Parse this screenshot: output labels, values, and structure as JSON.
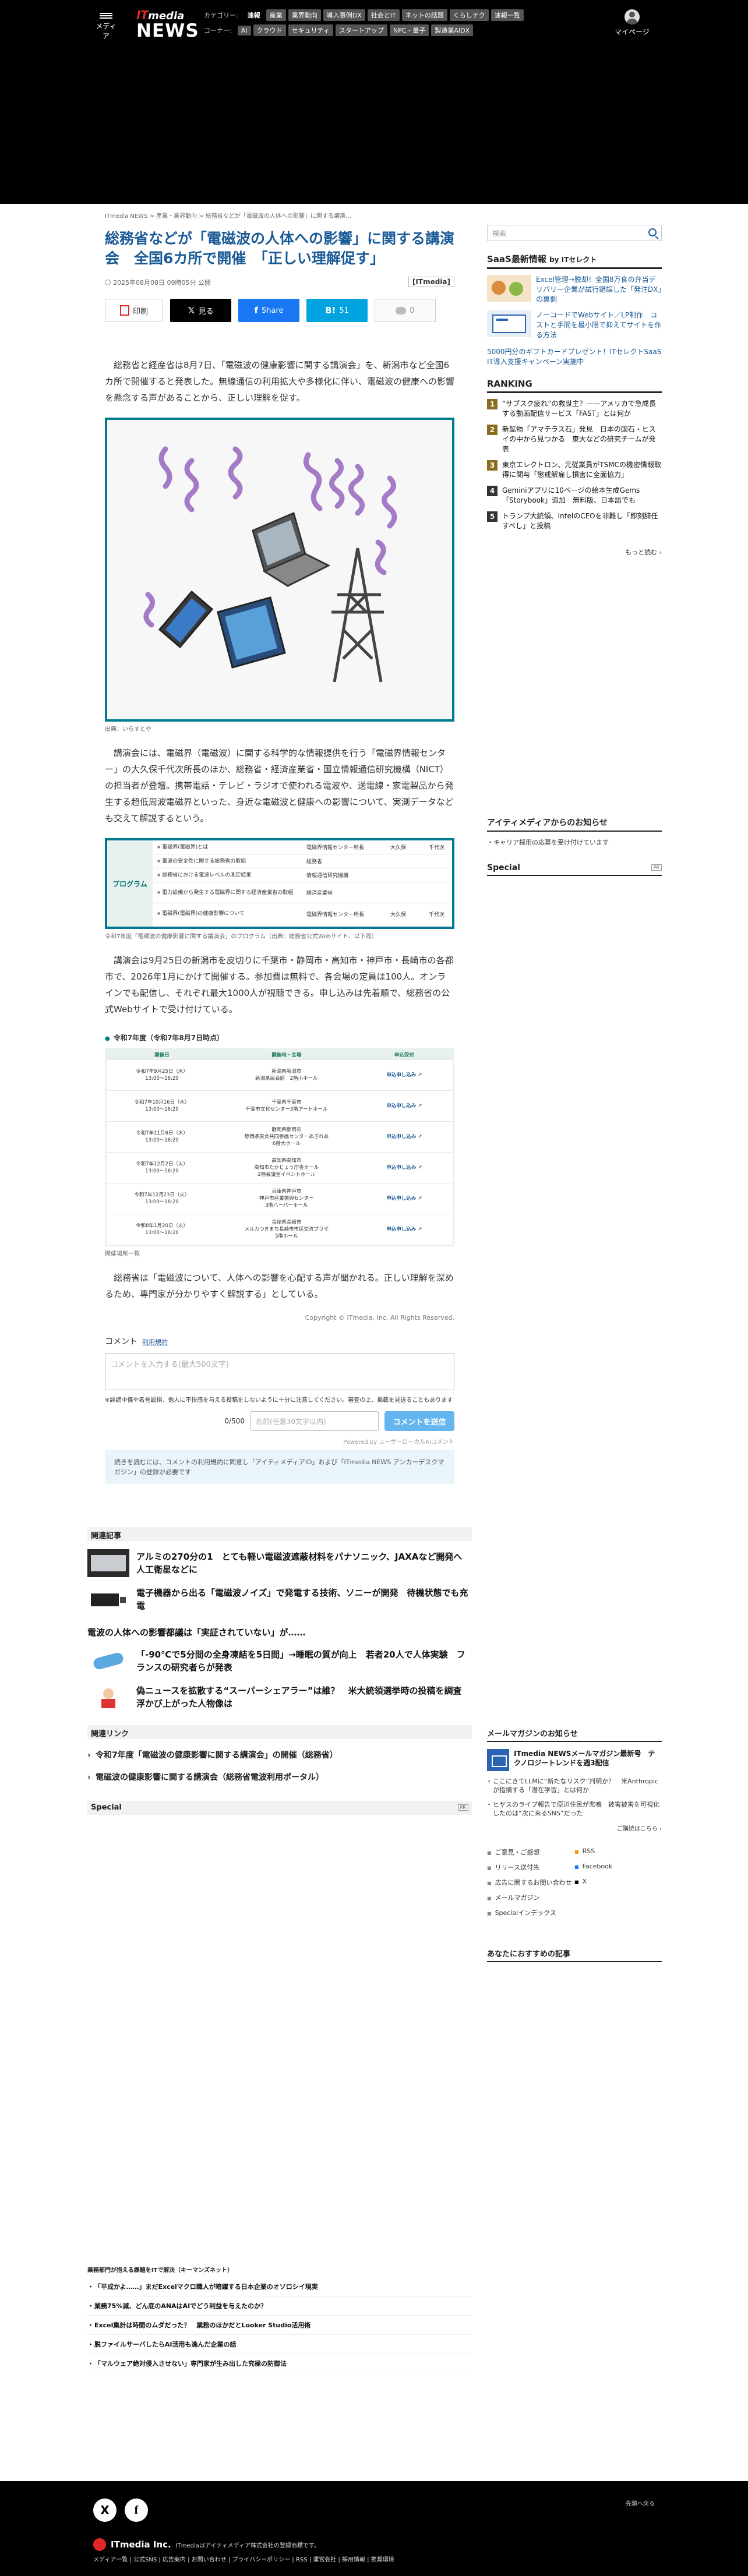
{
  "header": {
    "menu_label": "メディア",
    "logo_it": "IT",
    "logo_media": "media",
    "logo_news": "NEWS",
    "category_label": "カテゴリー:",
    "categories": [
      "速報",
      "産業",
      "業界動向",
      "導入事例DX",
      "社会とIT",
      "ネットの話題",
      "くらしテク",
      "速報一覧"
    ],
    "corner_label": "コーナー:",
    "corners": [
      "AI",
      "クラウド",
      "セキュリティ",
      "スタートアップ",
      "NPC・量子",
      "製造業AIDX"
    ],
    "mypage_label": "マイページ"
  },
  "breadcrumb": "ITmedia NEWS > 産業・業界動向 > 総務省などが「電磁波の人体への影響」に関する講演…",
  "article": {
    "title": "総務省などが「電磁波の人体への影響」に関する講演会　全国6カ所で開催　「正しい理解促す」",
    "datetime": "2025年08月08日 09時05分 公開",
    "source": "[ITmedia]",
    "share": {
      "print": "印刷",
      "x": "見る",
      "facebook": "Share",
      "hatena": "51",
      "comments": "0"
    },
    "lead": "総務省と経産省は8月7日、「電磁波の健康影響に関する講演会」を、新潟市など全国6カ所で開催すると発表した。無線通信の利用拡大や多様化に伴い、電磁波の健康への影響を懸念する声があることから、正しい理解を促す。",
    "fig_caption": "出典：いらすとや",
    "body2": "講演会には、電磁界（電磁波）に関する科学的な情報提供を行う「電磁界情報センター」の大久保千代次所長のほか、総務省・経済産業省・国立情報通信研究機構（NICT）の担当者が登壇。携帯電話・テレビ・ラジオで使われる電波や、送電線・家電製品から発生する超低周波電磁界といった、身近な電磁波と健康への影響について、実測データなども交えて解説するという。",
    "program": {
      "label": "プログラム",
      "rows": [
        {
          "c1": "電磁界(電磁界)とは",
          "c2": "電磁界情報センター所長",
          "c3": "大久保",
          "c4": "千代次"
        },
        {
          "c1": "電波の安全性に関する総務省の取組",
          "c2": "総務省",
          "c3": "",
          "c4": ""
        },
        {
          "c1": "総務省における電波レベルの測定結果",
          "c2": "情報通信研究機構",
          "c3": "",
          "c4": ""
        },
        {
          "c1": "電力設備から発生する電磁界に関する経済産業省の取組",
          "c2": "経済産業省",
          "c3": "",
          "c4": ""
        },
        {
          "c1": "電磁界(電磁界)の健康影響について",
          "c2": "電磁界情報センター所長",
          "c3": "大久保",
          "c4": "千代次"
        }
      ]
    },
    "program_caption": "令和7年度「電磁波の健康影響に関する講演会」のプログラム（出典：総務省公式Webサイト、以下同）",
    "body3": "講演会は9月25日の新潟市を皮切りに千葉市・静岡市・高知市・神戸市・長崎市の各都市で、2026年1月にかけて開催する。参加費は無料で、各会場の定員は100人。オンラインでも配信し、それぞれ最大1000人が視聴できる。申し込みは先着順で、総務省の公式Webサイトで受け付けている。",
    "schedule_title": "令和7年度（令和7年8月7日時点）",
    "schedule": {
      "headers": [
        "開催日",
        "開催地・会場",
        "申込受付"
      ],
      "rows": [
        {
          "date": "令和7年9月25日（木）\n13:00〜16:20",
          "place": "新潟県新潟市\n新潟県民会館　2階小ホール",
          "reg": "申込申し込み"
        },
        {
          "date": "令和7年10月16日（木）\n13:00〜16:20",
          "place": "千葉県千葉市\n千葉市文化センター3階アートホール",
          "reg": "申込申し込み"
        },
        {
          "date": "令和7年11月6日（木）\n13:00〜16:20",
          "place": "静岡県静岡市\n静岡県男女共同参画センターあざれあ\n6階大ホール",
          "reg": "申込申し込み"
        },
        {
          "date": "令和7年12月2日（火）\n13:00〜16:20",
          "place": "高知県高知市\n高知市たかじょう庁舎ホール\n2階会議室イベントホール",
          "reg": "申込申し込み"
        },
        {
          "date": "令和7年12月23日（火）\n13:00〜16:20",
          "place": "兵庫県神戸市\n神戸市産業振興センター\n3階ハーバーホール",
          "reg": "申込申し込み"
        },
        {
          "date": "令和8年1月20日（火）\n13:00〜16:20",
          "place": "長崎県長崎市\nメルカつきまち長崎市市民交流プラザ\n5階ホール",
          "reg": "申込申し込み"
        }
      ]
    },
    "schedule_caption": "開催場所一覧",
    "body4": "総務省は「電磁波について、人体への影響を心配する声が聞かれる。正しい理解を深めるため、専門家が分かりやすく解説する」としている。",
    "copyright": "Copyright © ITmedia, Inc. All Rights Reserved."
  },
  "comments": {
    "title": "コメント",
    "terms_link": "利用規約",
    "placeholder": "コメントを入力する(最大500文字)",
    "note": "※誹謗中傷や名誉毀損、他人に不快感を与える投稿をしないように十分に注意してください。審査の上、掲載を見送ることもあります",
    "counter": "0/500",
    "name_placeholder": "名前(任意30文字以内)",
    "send_label": "コメントを送信",
    "powered": "Powered by ユーザーローカルAIコメント",
    "agree": "続きを読むには、コメントの利用規約に同意し「アイティメディアID」および「ITmedia NEWS アンカーデスクマガジン」の登録が必要です"
  },
  "related": {
    "heading": "関連記事",
    "items": [
      "アルミの270分の1　とても軽い電磁波遮蔽材料をパナソニック、JAXAなど開発へ　人工衛星などに",
      "電子機器から出る「電磁波ノイズ」で発電する技術、ソニーが開発　待機状態でも充電",
      "電波の人体への影響都議は「実証されていない」が……",
      "「-90℃で5分間の全身凍結を5日間」→睡眠の質が向上　若者20人で人体実験　フランスの研究者らが発表",
      "偽ニュースを拡散する“スーパーシェアラー”は誰？　米大統領選挙時の投稿を調査　浮かび上がった人物像は"
    ],
    "links_heading": "関連リンク",
    "links": [
      "令和7年度「電磁波の健康影響に関する講演会」の開催（総務省）",
      "電磁波の健康影響に関する講演会（総務省電波利用ポータル）"
    ],
    "special_heading": "Special",
    "pr": "PR"
  },
  "biz": {
    "heading": "業務部門が抱える課題をITで解決（キーマンズネット）",
    "items": [
      "「平成かよ……」まだExcelマクロ職人が暗躍する日本企業のオソロシイ現実",
      "業務75%減、どん底のANAはAIでどう利益を与えたのか？",
      "Excel集計は時間のムダだった？　業務のほかだとLooker Studio活用術",
      "脱ファイルサーバしたらAI活用も進んだ企業の話",
      "「マルウェア絶対侵入させない」専門家が生み出した究極の防御法"
    ]
  },
  "sidebar": {
    "search_placeholder": "検索",
    "saas_heading": "SaaS最新情報",
    "saas_by": "by ITセレクト",
    "saas_items": [
      "Excel管理→脱却！全国8万食の弁当デリバリー企業が試行錯誤した「発注DX」の裏側",
      "ノーコードでWebサイト／LP制作　コストと手間を最小限で抑えてサイトを作る方法"
    ],
    "saas_text": "5000円分のギフトカードプレゼント！ITセレクトSaaS IT導入支援キャンペーン実施中",
    "ranking_heading": "RANKING",
    "ranking": [
      "“サブスク疲れ”の救世主？——アメリカで急成長する動画配信サービス「FAST」とは何か",
      "新鉱物「アマテラス石」発見　日本の国石・ヒスイの中から見つかる　東大などの研究チームが発表",
      "東京エレクトロン、元従業員がTSMCの機密情報取得に関与「懲戒解雇し損害に全面協力」",
      "Geminiアプリに10ページの絵本生成Gems「Storybook」追加　無料版、日本語でも",
      "トランプ大統領、IntelのCEOを非難し「即刻辞任すべし」と投稿"
    ],
    "more": "もっと読む ›",
    "info_heading": "アイティメディアからのお知らせ",
    "info_item": "キャリア採用の応募を受け付けています",
    "special_heading": "Special",
    "pr": "PR",
    "mail_heading": "メールマガジンのお知らせ",
    "mail_title": "ITmedia NEWSメールマガジン最新号　テクノロジートレンドを週3配信",
    "mail_items": [
      "ここにきてLLMに“新たなリスク”判明か？　米Anthropicが指摘する「潜在学習」とは何か",
      "ヒヤスのライブ報告で原辺住民が悲鳴　被害被害を可視化したのは“次に来るSNS”だった"
    ],
    "mail_reg": "ご購読はこちら ›",
    "links": [
      "ご意見・ご感想",
      "RSS",
      "リリース送付先",
      "Facebook",
      "広告に関するお問い合わせ",
      "X",
      "メールマガジン",
      "Specialインデックス"
    ],
    "recommend_heading": "あなたにおすすめの記事"
  },
  "footer": {
    "x_icon": "X",
    "fb_icon": "f",
    "top_link": "先頭へ戻る",
    "logo": "ITmedia Inc.",
    "logo_note": "ITmediaはアイティメディア株式会社の登録商標です。",
    "links": "メディア一覧 | 公式SNS | 広告案内 | お問い合わせ | プライバシーポリシー | RSS | 運営会社 | 採用情報 | 推奨環境"
  },
  "colors": {
    "title_blue": "#1a5a96",
    "accent_teal": "#007a8e",
    "logo_red": "#e3262a"
  }
}
